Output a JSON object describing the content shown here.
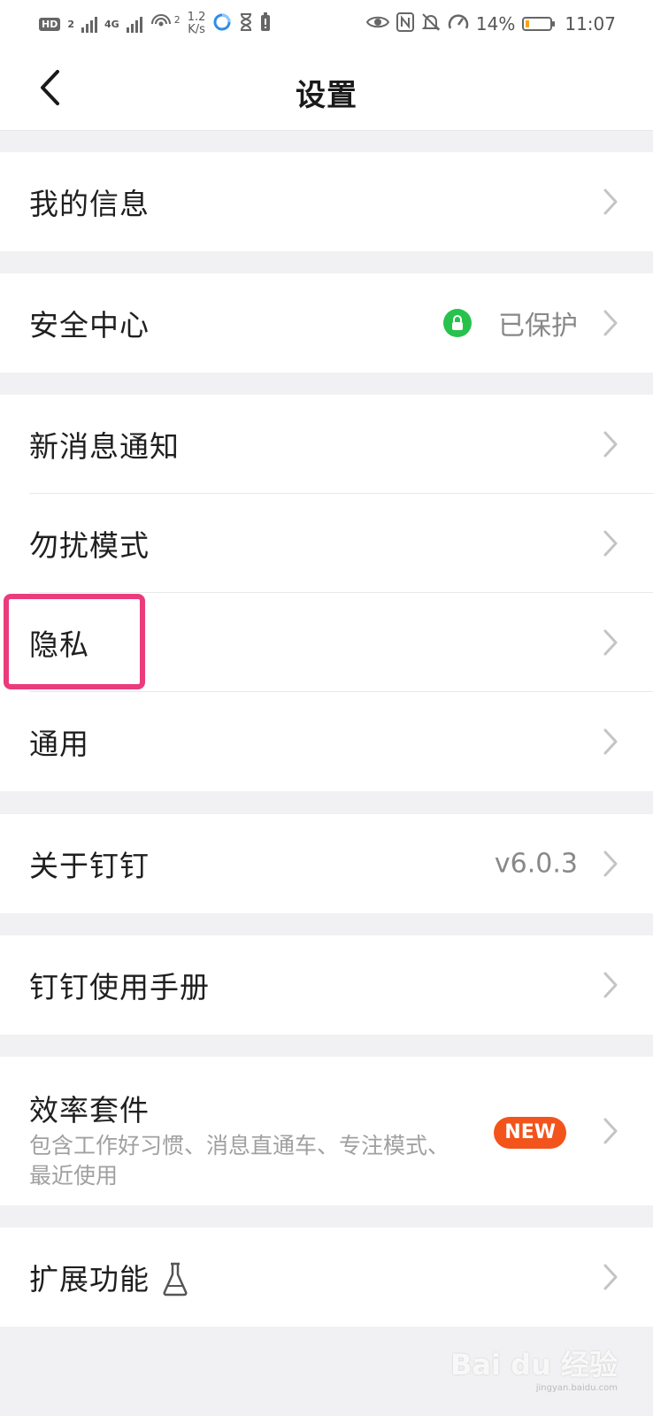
{
  "status_bar": {
    "hd": "HD",
    "sim": "2",
    "network": "4G",
    "hotspot_clients": "2",
    "speed_value": "1.2",
    "speed_unit": "K/s",
    "battery_percent": "14%",
    "battery_level": 0.14,
    "time": "11:07"
  },
  "header": {
    "title": "设置"
  },
  "settings": {
    "my_info": "我的信息",
    "security_center": "安全中心",
    "security_status": "已保护",
    "new_message_notification": "新消息通知",
    "do_not_disturb": "勿扰模式",
    "privacy": "隐私",
    "general": "通用",
    "about": "关于钉钉",
    "version": "v6.0.3",
    "manual": "钉钉使用手册",
    "efficiency_suite": "效率套件",
    "efficiency_desc": "包含工作好习惯、消息直通车、专注模式、最近使用",
    "new_badge": "NEW",
    "extensions": "扩展功能"
  },
  "watermark": {
    "text": "Bai du 经验",
    "sub": "jingyan.baidu.com"
  },
  "colors": {
    "highlight": "#ea3c7c",
    "secure_green": "#27c24c",
    "new_badge": "#f2541c",
    "background": "#f1f1f3"
  },
  "icons": [
    "back-arrow-icon",
    "lock-icon",
    "chevron-right-icon",
    "flask-icon",
    "eye-icon",
    "nfc-icon",
    "mute-bell-icon",
    "speedometer-icon",
    "battery-icon"
  ]
}
